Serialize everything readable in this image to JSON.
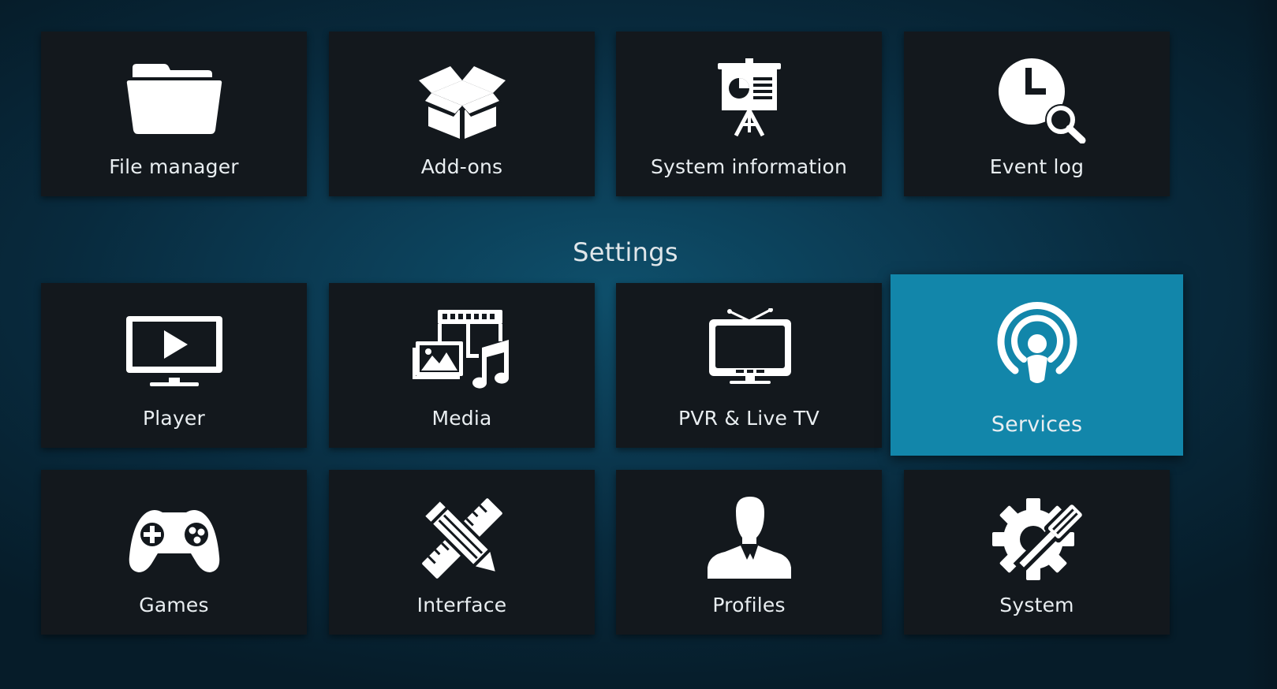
{
  "section_heading": "Settings",
  "colors": {
    "tile_background": "#13181d",
    "focused_tile_background": "#1286aa",
    "page_background": "#0b3a52",
    "icon_color": "#ffffff"
  },
  "top_row": [
    {
      "label": "File manager",
      "icon": "folder-icon"
    },
    {
      "label": "Add-ons",
      "icon": "open-box-icon"
    },
    {
      "label": "System information",
      "icon": "presentation-easel-icon"
    },
    {
      "label": "Event log",
      "icon": "clock-magnifier-icon"
    }
  ],
  "settings_rows": [
    [
      {
        "label": "Player",
        "icon": "tv-play-icon"
      },
      {
        "label": "Media",
        "icon": "media-collage-icon"
      },
      {
        "label": "PVR & Live TV",
        "icon": "antenna-tv-icon"
      },
      {
        "label": "Services",
        "icon": "broadcast-person-icon",
        "focused": true
      }
    ],
    [
      {
        "label": "Games",
        "icon": "gamepad-icon"
      },
      {
        "label": "Interface",
        "icon": "pencil-ruler-icon"
      },
      {
        "label": "Profiles",
        "icon": "person-silhouette-icon"
      },
      {
        "label": "System",
        "icon": "gear-screwdriver-icon"
      }
    ]
  ]
}
